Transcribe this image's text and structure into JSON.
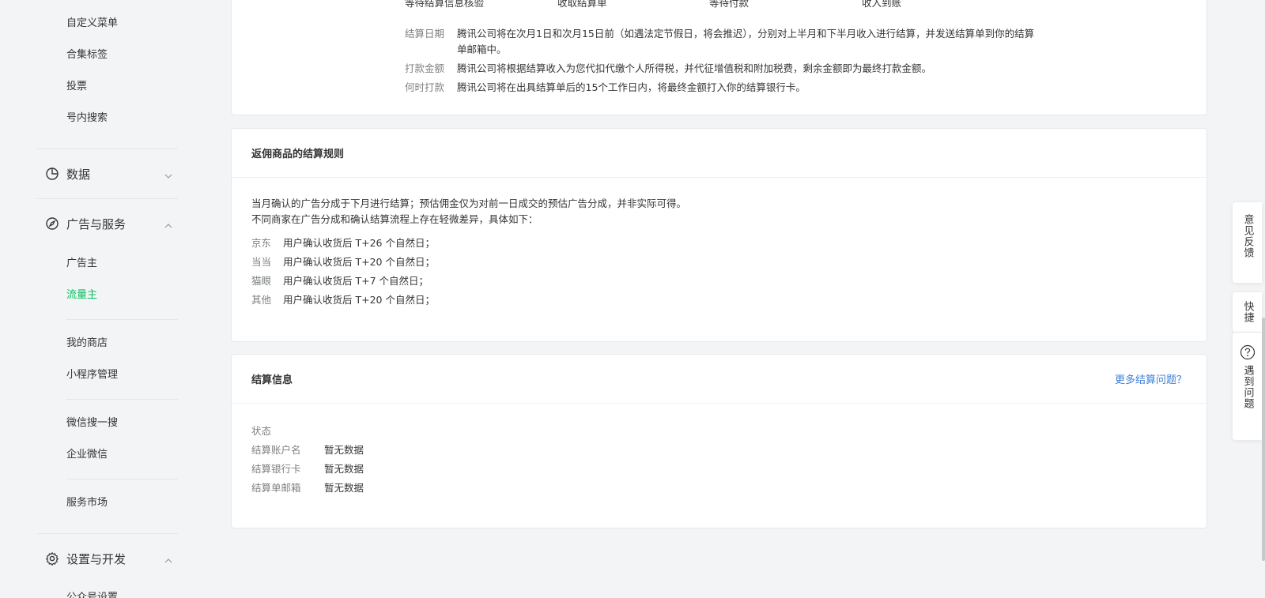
{
  "sidebar": {
    "top_items": [
      "自定义菜单",
      "合集标签",
      "投票",
      "号内搜索"
    ],
    "groups": {
      "data": {
        "label": "数据",
        "icon": "pie-chart-icon",
        "expanded": false
      },
      "ads": {
        "label": "广告与服务",
        "icon": "compass-icon",
        "expanded": true
      },
      "settings": {
        "label": "设置与开发",
        "icon": "gear-icon",
        "expanded": true
      }
    },
    "ads_items": {
      "advertiser": "广告主",
      "publisher": "流量主",
      "my_store": "我的商店",
      "mini_program": "小程序管理",
      "wechat_search": "微信搜一搜",
      "wecom": "企业微信",
      "service_market": "服务市场"
    },
    "settings_partial": "公众号设置",
    "active_color": "#07c160"
  },
  "top_card": {
    "cut_labels": [
      "等待结算信息核验",
      "收取结算单",
      "等待付款",
      "收入到账"
    ],
    "rules": [
      {
        "key": "结算日期",
        "value": "腾讯公司将在次月1日和次月15日前（如遇法定节假日，将会推迟），分别对上半月和下半月收入进行结算，并发送结算单到你的结算单邮箱中。"
      },
      {
        "key": "打款金额",
        "value": "腾讯公司将根据结算收入为您代扣代缴个人所得税，并代征增值税和附加税费，剩余金额即为最终打款金额。"
      },
      {
        "key": "何时打款",
        "value": "腾讯公司将在出具结算单后的15个工作日内，将最终金额打入你的结算银行卡。"
      }
    ]
  },
  "commission_card": {
    "title": "返佣商品的结算规则",
    "lines": [
      "当月确认的广告分成于下月进行结算；预估佣金仅为对前一日成交的预估广告分成，并非实际可得。",
      "不同商家在广告分成和确认结算流程上存在轻微差异，具体如下："
    ],
    "merchants": [
      {
        "key": "京东",
        "value": "用户确认收货后 T+26 个自然日；"
      },
      {
        "key": "当当",
        "value": "用户确认收货后 T+20 个自然日；"
      },
      {
        "key": "猫眼",
        "value": "用户确认收货后 T+7 个自然日；"
      },
      {
        "key": "其他",
        "value": "用户确认收货后 T+20 个自然日；"
      }
    ]
  },
  "settlement_card": {
    "title": "结算信息",
    "link": "更多结算问题？",
    "status_label": "状态",
    "fields": [
      {
        "key": "结算账户名",
        "value": "暂无数据"
      },
      {
        "key": "结算银行卡",
        "value": "暂无数据"
      },
      {
        "key": "结算单邮箱",
        "value": "暂无数据"
      }
    ]
  },
  "float_tabs": {
    "feedback": "意见反馈",
    "shortcut": "快捷",
    "help": "遇到问题",
    "help_icon": "question-circle-icon"
  }
}
